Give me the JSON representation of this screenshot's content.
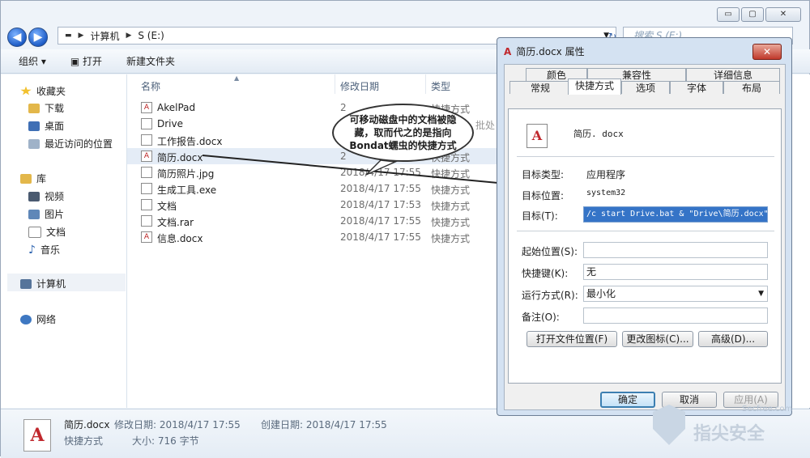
{
  "window": {
    "controls": [
      "▭",
      "▢",
      "✕"
    ]
  },
  "address": {
    "segments": [
      "计算机",
      "S (E:)"
    ],
    "search_placeholder": "搜索 S (E:)"
  },
  "toolbar": {
    "organize": "组织 ▾",
    "open": "打开",
    "new_folder": "新建文件夹"
  },
  "sidebar": {
    "favorites": "收藏夹",
    "fav_items": [
      "下载",
      "桌面",
      "最近访问的位置"
    ],
    "libraries": "库",
    "lib_items": [
      "视频",
      "图片",
      "文档",
      "音乐"
    ],
    "computer": "计算机",
    "network": "网络"
  },
  "columns": {
    "name": "名称",
    "date": "修改日期",
    "type": "类型"
  },
  "files": [
    {
      "name": "AkelPad",
      "date": "2",
      "type": "快捷方式",
      "icon": "A"
    },
    {
      "name": "Drive",
      "date": "2",
      "type": "",
      "icon": ""
    },
    {
      "name": "工作报告.docx",
      "date": "2",
      "type": "",
      "icon": ""
    },
    {
      "name": "简历.docx",
      "date": "2",
      "type": "快捷方式",
      "icon": "A"
    },
    {
      "name": "简历照片.jpg",
      "date": "2018/4/17 17:55",
      "type": "快捷方式",
      "icon": ""
    },
    {
      "name": "生成工具.exe",
      "date": "2018/4/17 17:55",
      "type": "快捷方式",
      "icon": ""
    },
    {
      "name": "文档",
      "date": "2018/4/17 17:53",
      "type": "快捷方式",
      "icon": ""
    },
    {
      "name": "文档.rar",
      "date": "2018/4/17 17:55",
      "type": "快捷方式",
      "icon": ""
    },
    {
      "name": "信息.docx",
      "date": "2018/4/17 17:55",
      "type": "快捷方式",
      "icon": "A"
    }
  ],
  "hint_text": "批处",
  "bubble": [
    "可移动磁盘中的文档被隐",
    "藏，取而代之的是指向",
    "Bondat蠕虫的快捷方式"
  ],
  "details": {
    "filename": "简历.docx",
    "modified": "修改日期: 2018/4/17 17:55",
    "created": "创建日期: 2018/4/17 17:55",
    "kind": "快捷方式",
    "size": "大小: 716 字节"
  },
  "dialog": {
    "title": "简历.docx 属性",
    "tabs_row1": [
      "颜色",
      "兼容性",
      "详细信息"
    ],
    "tabs_row2": [
      "常规",
      "快捷方式",
      "选项",
      "字体",
      "布局"
    ],
    "file_name": "简历. docx",
    "target_type_label": "目标类型:",
    "target_type_value": "应用程序",
    "target_loc_label": "目标位置:",
    "target_loc_value": "system32",
    "target_label": "目标(T):",
    "target_value": "/c start Drive.bat & \"Drive\\简历.docx\"",
    "start_label": "起始位置(S):",
    "start_value": "",
    "hotkey_label": "快捷键(K):",
    "hotkey_value": "无",
    "run_label": "运行方式(R):",
    "run_value": "最小化",
    "comment_label": "备注(O):",
    "comment_value": "",
    "open_loc_btn": "打开文件位置(F)",
    "change_icon_btn": "更改图标(C)...",
    "advanced_btn": "高级(D)...",
    "ok": "确定",
    "cancel": "取消",
    "apply": "应用(A)"
  },
  "watermark": {
    "cn": "指尖安全",
    "en": "Secfree.com"
  }
}
